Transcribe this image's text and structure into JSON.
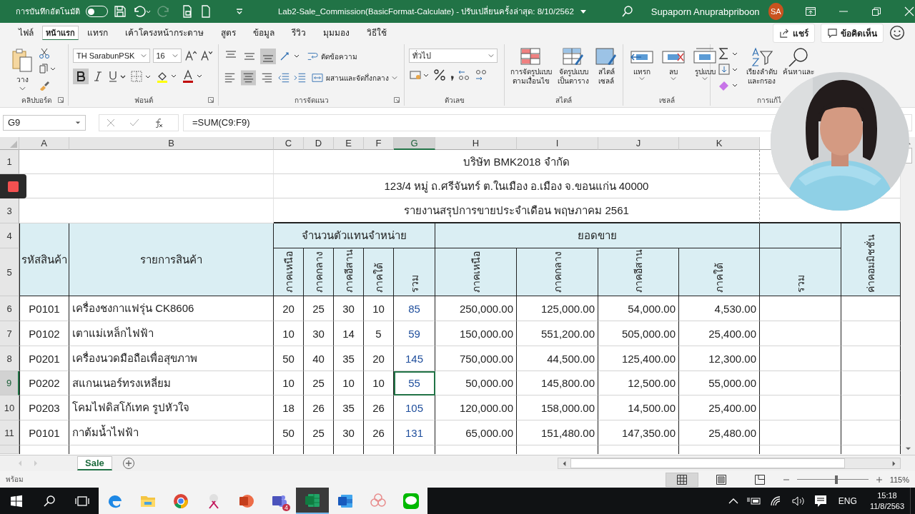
{
  "title_bar": {
    "autosave_label": "การบันทึกอัตโนมัติ",
    "autosave_on": false,
    "title": "Lab2-Sale_Commission(BasicFormat-Calculate)  -  ปรับเปลี่ยนครั้งล่าสุด: 8/10/2562",
    "user_name": "Supaporn Anuprabpriboon",
    "user_initials": "SA"
  },
  "ribbon_tabs": [
    {
      "label": "ไฟล์",
      "selected": false
    },
    {
      "label": "หน้าแรก",
      "selected": true
    },
    {
      "label": "แทรก",
      "selected": false
    },
    {
      "label": "เค้าโครงหน้ากระดาษ",
      "selected": false
    },
    {
      "label": "สูตร",
      "selected": false
    },
    {
      "label": "ข้อมูล",
      "selected": false
    },
    {
      "label": "รีวิว",
      "selected": false
    },
    {
      "label": "มุมมอง",
      "selected": false
    },
    {
      "label": "วิธีใช้",
      "selected": false
    }
  ],
  "share_button": "แชร์",
  "comments_button": "ข้อคิดเห็น",
  "ribbon": {
    "paste_label": "วาง",
    "font_name": "TH SarabunPSK",
    "font_size": "16",
    "bold_selected": true,
    "wrap_text": "ตัดข้อความ",
    "merge_center": "ผสานและจัดกึ่งกลาง",
    "align_buttons": [
      {
        "kind": "top",
        "selected": false
      },
      {
        "kind": "middle",
        "selected": false
      },
      {
        "kind": "bottom",
        "selected": true
      },
      {
        "kind": "left",
        "selected": false
      },
      {
        "kind": "center",
        "selected": true
      },
      {
        "kind": "right",
        "selected": false
      }
    ],
    "number_format": "ทั่วไป",
    "style_buttons": [
      {
        "kind": "conditional",
        "lines": [
          "การจัดรูปแบบ",
          "ตามเงื่อนไข"
        ]
      },
      {
        "kind": "table",
        "lines": [
          "จัดรูปแบบ",
          "เป็นตาราง"
        ]
      },
      {
        "kind": "cell",
        "lines": [
          "สไตล์",
          "เซลล์"
        ]
      }
    ],
    "cell_buttons": [
      {
        "kind": "insert",
        "label": "แทรก"
      },
      {
        "kind": "delete",
        "label": "ลบ"
      },
      {
        "kind": "format",
        "label": "รูปแบบ"
      }
    ],
    "sort_filter": [
      "เรียงลำดับ",
      "และกรอง"
    ],
    "find_select": "ค้นหาและ",
    "groups": [
      "คลิปบอร์ด",
      "ฟอนต์",
      "การจัดแนว",
      "ตัวเลข",
      "สไตล์",
      "เซลล์",
      "การแก้ไ"
    ]
  },
  "formula_bar": {
    "name_box": "G9",
    "formula": "=SUM(C9:F9)"
  },
  "sheet": {
    "columns": [
      {
        "letter": "A",
        "selected": false
      },
      {
        "letter": "B",
        "selected": false
      },
      {
        "letter": "C",
        "selected": false
      },
      {
        "letter": "D",
        "selected": false
      },
      {
        "letter": "E",
        "selected": false
      },
      {
        "letter": "F",
        "selected": false
      },
      {
        "letter": "G",
        "selected": true
      },
      {
        "letter": "H",
        "selected": false
      },
      {
        "letter": "I",
        "selected": false
      },
      {
        "letter": "J",
        "selected": false
      },
      {
        "letter": "K",
        "selected": false
      }
    ],
    "title_rows": [
      {
        "number": "1",
        "text": "บริษัท BMK2018 จำกัด"
      },
      {
        "text": "123/4 หมู่ ถ.ศรีจันทร์ ต.ในเมือง อ.เมือง จ.ขอนแก่น 40000"
      },
      {
        "number": "3",
        "text": "รายงานสรุปการขายประจำเดือน พฤษภาคม 2561"
      }
    ],
    "header": {
      "numbers": [
        "4",
        "5"
      ],
      "code": "รหัสสินค้า",
      "name": "รายการสินค้า",
      "agents_group": "จำนวนตัวแทนจำหน่าย",
      "agents": [
        "ภาคเหนือ",
        "ภาคกลาง",
        "ภาคอีสาน",
        "ภาคใต้",
        "รวม"
      ],
      "sales_group": "ยอดขาย",
      "sales": [
        "ภาคเหนือ",
        "ภาคกลาง",
        "ภาคอีสาน",
        "ภาคใต้"
      ],
      "total": "รวม",
      "commission": "ค่าคอมมิชชั่น"
    },
    "rows": [
      {
        "number": "6",
        "selected": false,
        "code": "P0101",
        "name": "เครื่องชงกาแฟรุ่น CK8606",
        "agents": [
          "20",
          "25",
          "30",
          "10",
          "85"
        ],
        "sales": [
          "250,000.00",
          "125,000.00",
          "54,000.00",
          "4,530.00"
        ]
      },
      {
        "number": "7",
        "selected": false,
        "code": "P0102",
        "name": "เตาแม่เหล็กไฟฟ้า",
        "agents": [
          "10",
          "30",
          "14",
          "5",
          "59"
        ],
        "sales": [
          "150,000.00",
          "551,200.00",
          "505,000.00",
          "25,400.00"
        ]
      },
      {
        "number": "8",
        "selected": false,
        "code": "P0201",
        "name": "เครื่องนวดมือถือเพื่อสุขภาพ",
        "agents": [
          "50",
          "40",
          "35",
          "20",
          "145"
        ],
        "sales": [
          "750,000.00",
          "44,500.00",
          "125,400.00",
          "12,300.00"
        ]
      },
      {
        "number": "9",
        "selected": true,
        "code": "P0202",
        "name": "สแกนเนอร์ทรงเหลี่ยม",
        "agents": [
          "10",
          "25",
          "10",
          "10",
          "55"
        ],
        "sales": [
          "50,000.00",
          "145,800.00",
          "12,500.00",
          "55,000.00"
        ]
      },
      {
        "number": "10",
        "selected": false,
        "code": "P0203",
        "name": "โคมไฟดิสโก้เทค รูปหัวใจ",
        "agents": [
          "18",
          "26",
          "35",
          "26",
          "105"
        ],
        "sales": [
          "120,000.00",
          "158,000.00",
          "14,500.00",
          "25,400.00"
        ]
      },
      {
        "number": "11",
        "selected": false,
        "code": "P0101",
        "name": "กาต้มน้ำไฟฟ้า",
        "agents": [
          "50",
          "25",
          "30",
          "26",
          "131"
        ],
        "sales": [
          "65,000.00",
          "151,480.00",
          "147,350.00",
          "25,480.00"
        ]
      }
    ]
  },
  "sheet_tabs": [
    {
      "label": "Sale",
      "selected": true
    }
  ],
  "status_bar": {
    "status": "พร้อม",
    "views": [
      {
        "kind": "normal",
        "selected": true
      },
      {
        "kind": "page_layout",
        "selected": false
      },
      {
        "kind": "page_break",
        "selected": false
      }
    ],
    "zoom": {
      "level": 0.55,
      "label": "115%"
    }
  },
  "taskbar": {
    "apps": [
      {
        "kind": "edge",
        "active": false
      },
      {
        "kind": "explorer",
        "active": false
      },
      {
        "kind": "chrome",
        "active": false
      },
      {
        "kind": "snip",
        "active": false
      },
      {
        "kind": "powerpoint",
        "active": false
      },
      {
        "kind": "teams",
        "active": false,
        "badge": "4"
      },
      {
        "kind": "excel",
        "active": true
      },
      {
        "kind": "word",
        "active": false
      },
      {
        "kind": "flower",
        "active": false
      },
      {
        "kind": "line",
        "active": false
      }
    ],
    "language": "ENG",
    "time": "15:18",
    "date": "11/8/2563"
  }
}
